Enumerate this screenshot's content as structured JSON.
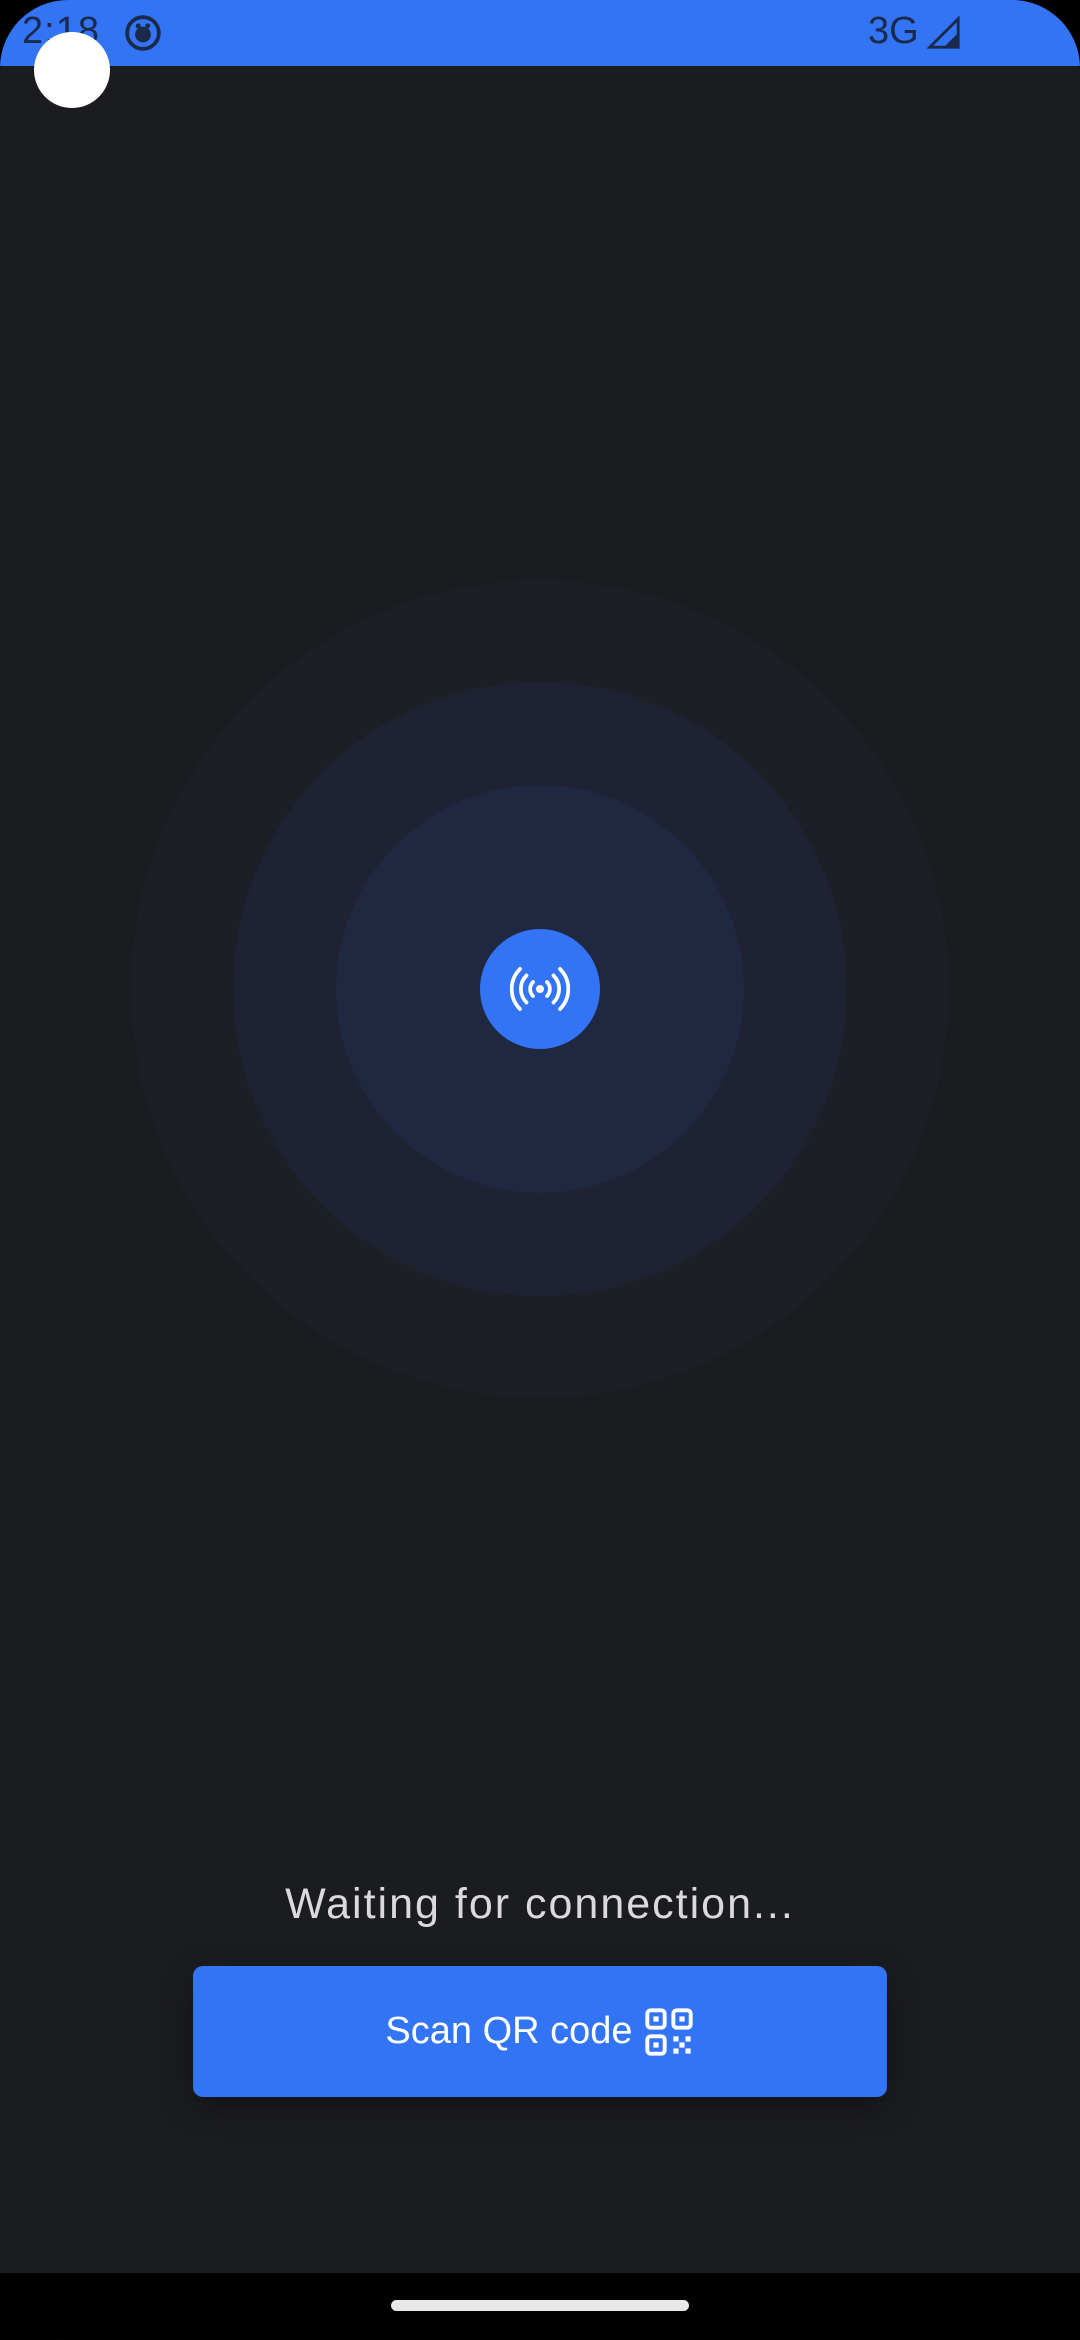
{
  "status_bar": {
    "time": "2:18",
    "network": "3G",
    "color": "#3274f4"
  },
  "main": {
    "center_icon": "wireless-broadcast-icon",
    "status_text": "Waiting for connection...",
    "scan_button": {
      "label": "Scan QR code",
      "icon": "qr-code-icon"
    },
    "accent_color": "#3274f4",
    "background_color": "#1b1c20"
  }
}
